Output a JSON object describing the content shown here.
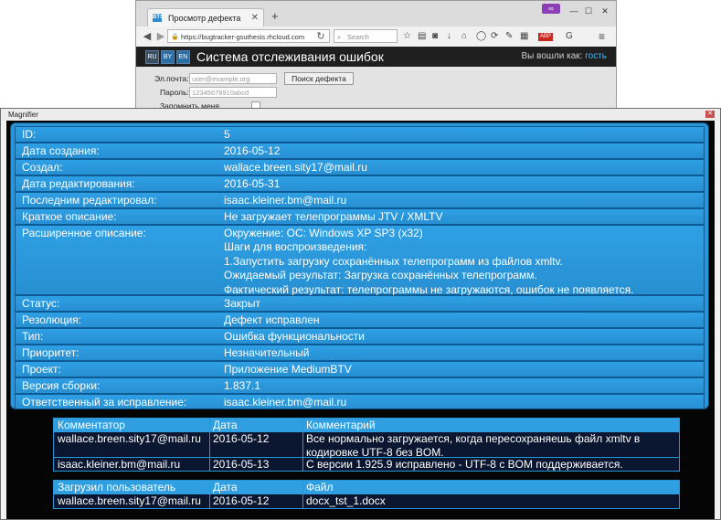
{
  "browser": {
    "tab_title": "Просмотр дефекта",
    "favicon_text": "BTS",
    "new_tab_symbol": "+",
    "url": "https://bugtracker-gsuthesis.rhcloud.com",
    "search_placeholder": "Search",
    "abp_badge": "ABP"
  },
  "app": {
    "languages": [
      "RU",
      "BY",
      "EN"
    ],
    "title": "Система отслеживания ошибок",
    "login_prefix": "Вы вошли как:",
    "login_user": "гость",
    "login_form": {
      "email_label": "Эл.почта:",
      "email_placeholder": "user@example.org",
      "password_label": "Пароль:",
      "password_value": "12345678910abcd",
      "remember_label": "Запомнить меня",
      "search_defect_button": "Поиск дефекта"
    }
  },
  "magnifier": {
    "title": "Magnifier"
  },
  "defect": {
    "fields": [
      {
        "label": "ID:",
        "value": [
          "5"
        ]
      },
      {
        "label": "Дата создания:",
        "value": [
          "2016-05-12"
        ]
      },
      {
        "label": "Создал:",
        "value": [
          "wallace.breen.sity17@mail.ru"
        ]
      },
      {
        "label": "Дата редактирования:",
        "value": [
          "2016-05-31"
        ]
      },
      {
        "label": "Последним редактировал:",
        "value": [
          "isaac.kleiner.bm@mail.ru"
        ]
      },
      {
        "label": "Краткое описание:",
        "value": [
          "Не загружает телепрограммы JTV / XMLTV"
        ]
      },
      {
        "label": "Расширенное описание:",
        "value": [
          "Окружение: ОС: Windows XP SP3 (x32)",
          "Шаги для воспроизведения:",
          "1.Запустить загрузку сохранённых телепрограмм из файлов xmltv.",
          "Ожидаемый результат: Загрузка сохранённых телепрограмм.",
          "Фактический результат: телепрограммы не загружаются, ошибок не появляется."
        ]
      },
      {
        "label": "Статус:",
        "value": [
          "Закрыт"
        ]
      },
      {
        "label": "Резолюция:",
        "value": [
          "Дефект исправлен"
        ]
      },
      {
        "label": "Тип:",
        "value": [
          "Ошибка функциональности"
        ]
      },
      {
        "label": "Приоритет:",
        "value": [
          "Незначительный"
        ]
      },
      {
        "label": "Проект:",
        "value": [
          "Приложение MediumBTV"
        ]
      },
      {
        "label": "Версия сборки:",
        "value": [
          "1.837.1"
        ]
      },
      {
        "label": "Ответственный за исправление:",
        "value": [
          "isaac.kleiner.bm@mail.ru"
        ]
      }
    ]
  },
  "comments": {
    "headers": [
      "Комментатор",
      "Дата",
      "Комментарий"
    ],
    "rows": [
      [
        "wallace.breen.sity17@mail.ru",
        "2016-05-12",
        "Все нормально загружается, когда пересохраняешь файл xmltv в\nкодировке UTF-8 без BOM."
      ],
      [
        "isaac.kleiner.bm@mail.ru",
        "2016-05-13",
        "С версии 1.925.9 исправлено - UTF-8 с BOM поддерживается."
      ]
    ]
  },
  "attachments": {
    "headers": [
      "Загрузил пользователь",
      "Дата",
      "Файл"
    ],
    "rows": [
      [
        "wallace.breen.sity17@mail.ru",
        "2016-05-12",
        "docx_tst_1.docx"
      ]
    ]
  },
  "colors": {
    "panel_blue": "#2a96d8",
    "header_blue": "#2f9fe2",
    "magnifier_bg": "#050505"
  }
}
